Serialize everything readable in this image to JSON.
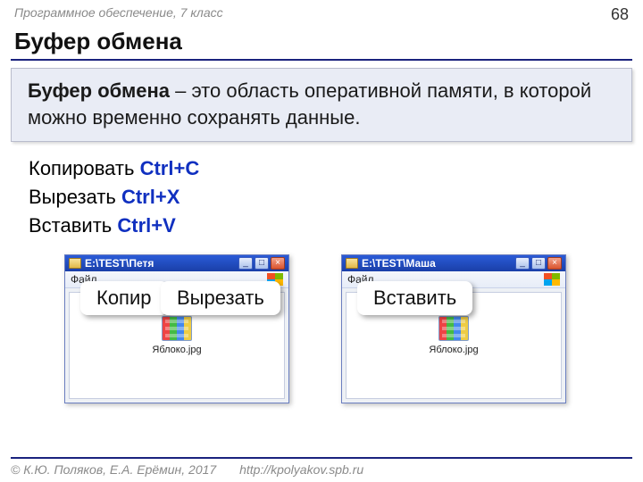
{
  "meta": {
    "course": "Программное обеспечение, 7 класс",
    "page": "68"
  },
  "title": "Буфер обмена",
  "definition": {
    "term": "Буфер обмена",
    "rest": " – это область оперативной памяти, в которой можно временно сохранять данные."
  },
  "shortcuts": {
    "copy": {
      "label": "Копировать ",
      "kbd": "Ctrl+C"
    },
    "cut": {
      "label": "Вырезать ",
      "kbd": "Ctrl+X"
    },
    "paste": {
      "label": "Вставить ",
      "kbd": "Ctrl+V"
    }
  },
  "explorers": {
    "left": {
      "title": "E:\\TEST\\Петя",
      "menu_file": "Файл",
      "file": "Яблоко.jpg"
    },
    "right": {
      "title": "E:\\TEST\\Маша",
      "menu_file": "Файл",
      "file": "Яблоко.jpg"
    }
  },
  "winbtn": {
    "min": "_",
    "max": "□",
    "close": "×"
  },
  "callouts": {
    "copy": "Копир",
    "cut": "Вырезать",
    "paste": "Вставить"
  },
  "footer": {
    "authors": "© К.Ю. Поляков, Е.А. Ерёмин, 2017",
    "url": "http://kpolyakov.spb.ru"
  }
}
